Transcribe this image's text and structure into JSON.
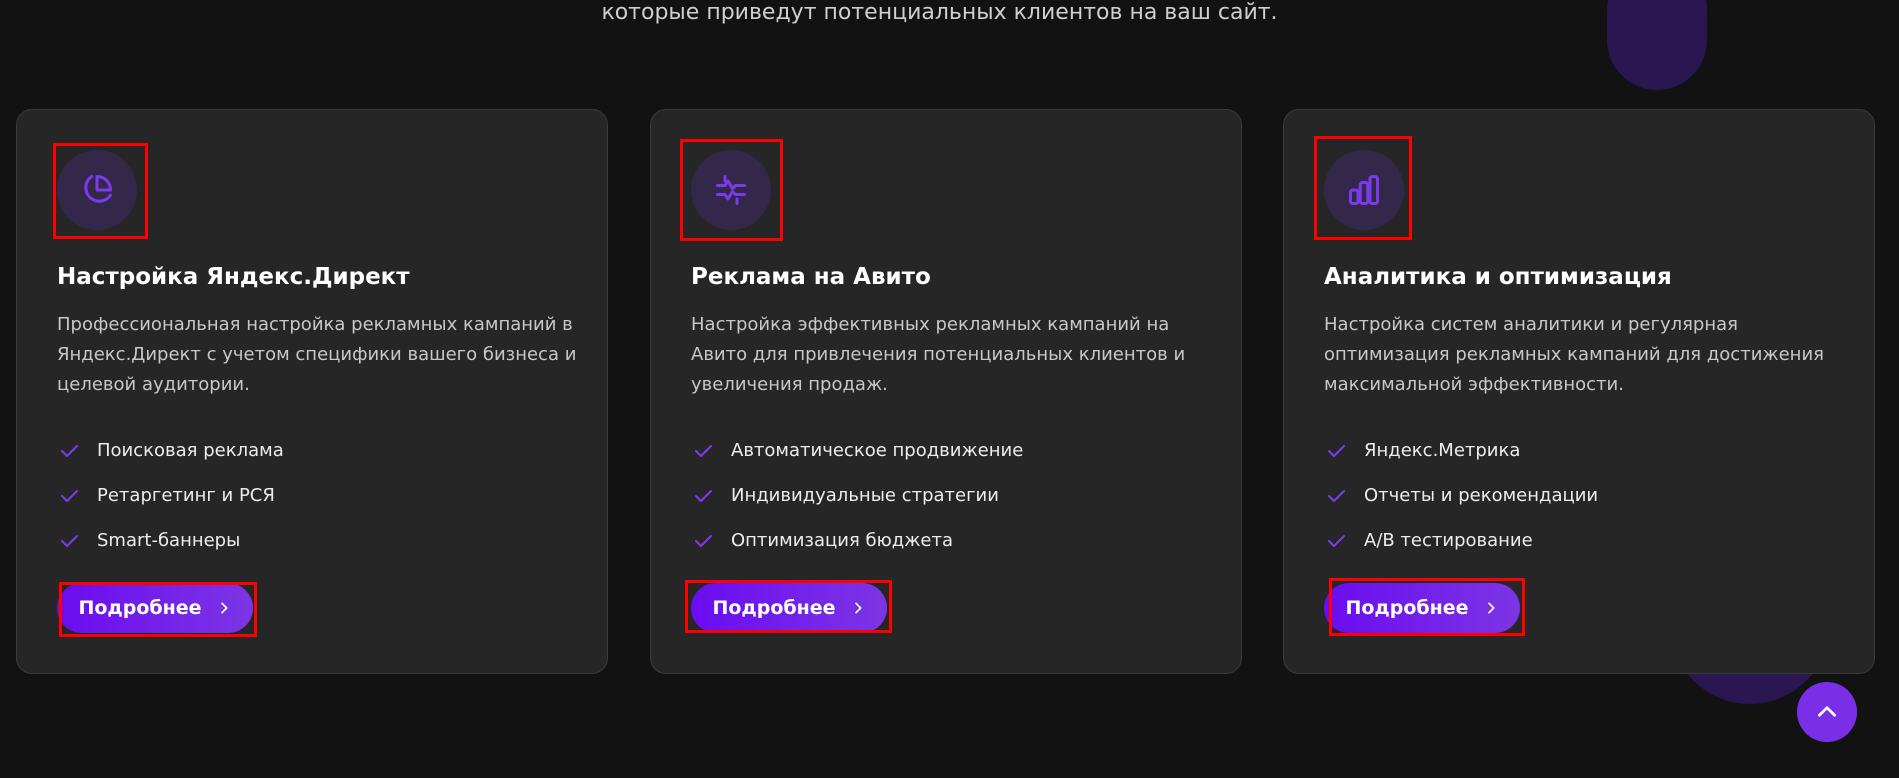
{
  "section": {
    "subtitle": "которые приведут потенциальных клиентов на ваш сайт."
  },
  "colors": {
    "accent": "#7c3aed",
    "card_bg": "#262626",
    "page_bg": "#121212",
    "highlight": "#ff0000"
  },
  "cards": [
    {
      "icon": "pie-chart-icon",
      "title": "Настройка Яндекс.Директ",
      "description": "Профессиональная настройка рекламных кампаний в Яндекс.Директ с учетом специфики вашего бизнеса и целевой аудитории.",
      "features": [
        "Поисковая реклама",
        "Ретаргетинг и РСЯ",
        "Smart-баннеры"
      ],
      "button": "Подробнее"
    },
    {
      "icon": "arrows-collapse-icon",
      "title": "Реклама на Авито",
      "description": "Настройка эффективных рекламных кампаний на Авито для привлечения потенциальных клиентов и увеличения продаж.",
      "features": [
        "Автоматическое продвижение",
        "Индивидуальные стратегии",
        "Оптимизация бюджета"
      ],
      "button": "Подробнее"
    },
    {
      "icon": "bar-chart-icon",
      "title": "Аналитика и оптимизация",
      "description": "Настройка систем аналитики и регулярная оптимизация рекламных кампаний для достижения максимальной эффективности.",
      "features": [
        "Яндекс.Метрика",
        "Отчеты и рекомендации",
        "A/B тестирование"
      ],
      "button": "Подробнее"
    }
  ],
  "scroll_top": {
    "icon": "chevron-up-icon"
  }
}
